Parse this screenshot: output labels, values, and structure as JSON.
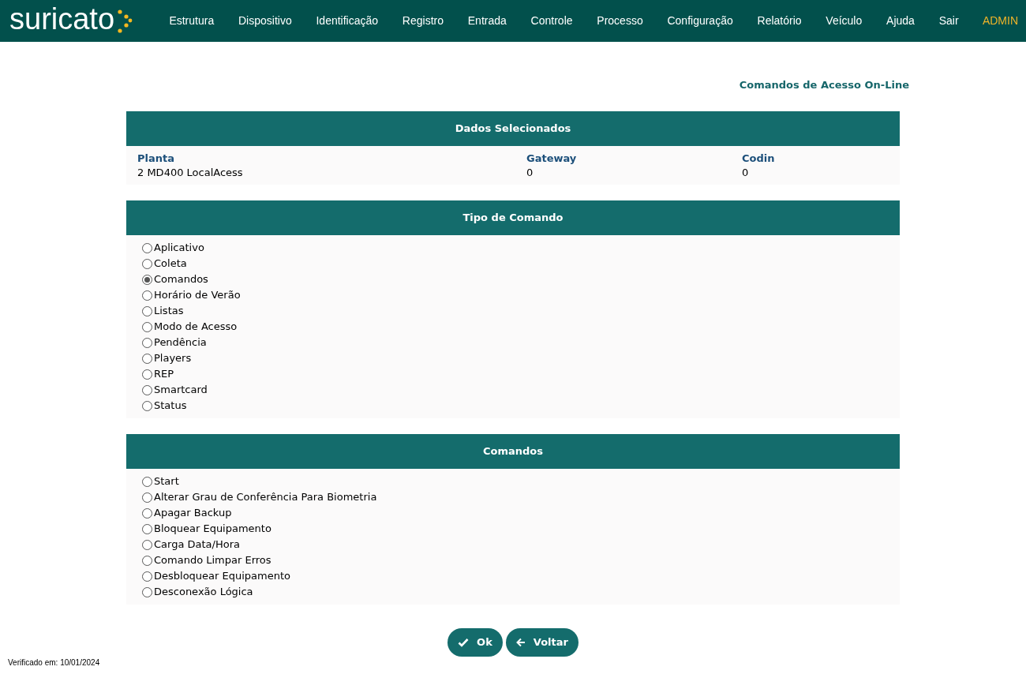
{
  "header": {
    "logo": "suricato",
    "nav": [
      "Estrutura",
      "Dispositivo",
      "Identificação",
      "Registro",
      "Entrada",
      "Controle",
      "Processo",
      "Configuração",
      "Relatório",
      "Veículo",
      "Ajuda",
      "Sair"
    ],
    "user": "ADMIN"
  },
  "page_title": "Comandos de Acesso On-Line",
  "selected_data": {
    "title": "Dados Selecionados",
    "fields": [
      {
        "label": "Planta",
        "value": "2 MD400 LocalAcess"
      },
      {
        "label": "Gateway",
        "value": "0"
      },
      {
        "label": "Codin",
        "value": "0"
      }
    ]
  },
  "command_type": {
    "title": "Tipo de Comando",
    "options": [
      {
        "label": "Aplicativo",
        "selected": false
      },
      {
        "label": "Coleta",
        "selected": false
      },
      {
        "label": "Comandos",
        "selected": true
      },
      {
        "label": "Horário de Verão",
        "selected": false
      },
      {
        "label": "Listas",
        "selected": false
      },
      {
        "label": "Modo de Acesso",
        "selected": false
      },
      {
        "label": "Pendência",
        "selected": false
      },
      {
        "label": "Players",
        "selected": false
      },
      {
        "label": "REP",
        "selected": false
      },
      {
        "label": "Smartcard",
        "selected": false
      },
      {
        "label": "Status",
        "selected": false
      }
    ]
  },
  "commands": {
    "title": "Comandos",
    "options": [
      {
        "label": "Start",
        "selected": false
      },
      {
        "label": "Alterar Grau de Conferência Para Biometria",
        "selected": false
      },
      {
        "label": "Apagar Backup",
        "selected": false
      },
      {
        "label": "Bloquear Equipamento",
        "selected": false
      },
      {
        "label": "Carga Data/Hora",
        "selected": false
      },
      {
        "label": "Comando Limpar Erros",
        "selected": false
      },
      {
        "label": "Desbloquear Equipamento",
        "selected": false
      },
      {
        "label": "Desconexão Lógica",
        "selected": false
      }
    ]
  },
  "buttons": [
    {
      "kind": "ok",
      "label": "Ok"
    },
    {
      "kind": "back",
      "label": "Voltar"
    }
  ],
  "footer": "Verificado em: 10/01/2024"
}
